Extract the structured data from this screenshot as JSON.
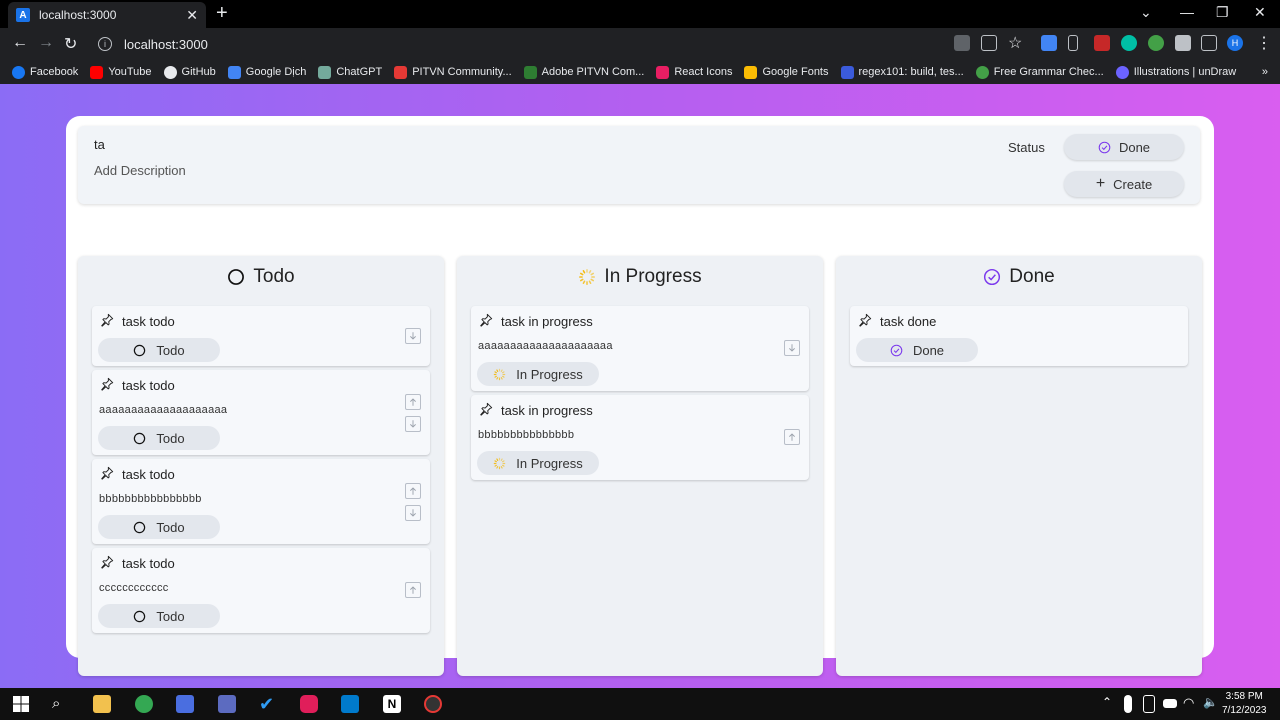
{
  "browser": {
    "tab_title": "localhost:3000",
    "tab_icon_letter": "A",
    "url": "localhost:3000",
    "bookmarks": [
      {
        "label": "Facebook",
        "icon": "facebook-icon",
        "color": "#1877f2"
      },
      {
        "label": "YouTube",
        "icon": "youtube-icon",
        "color": "#ff0000"
      },
      {
        "label": "GitHub",
        "icon": "github-icon",
        "color": "#e8eaed"
      },
      {
        "label": "Google Dịch",
        "icon": "google-translate-icon",
        "color": "#4285f4"
      },
      {
        "label": "ChatGPT",
        "icon": "chatgpt-icon",
        "color": "#74aa9c"
      },
      {
        "label": "PITVN Community...",
        "icon": "pitvn-icon",
        "color": "#e53935"
      },
      {
        "label": "Adobe PITVN Com...",
        "icon": "adobe-icon",
        "color": "#2e7d32"
      },
      {
        "label": "React Icons",
        "icon": "react-icons-icon",
        "color": "#e91e63"
      },
      {
        "label": "Google Fonts",
        "icon": "google-fonts-icon",
        "color": "#fbbc04"
      },
      {
        "label": "regex101: build, tes...",
        "icon": "regex101-icon",
        "color": "#3b5bdb"
      },
      {
        "label": "Free Grammar Chec...",
        "icon": "grammar-icon",
        "color": "#43a047"
      },
      {
        "label": "Illustrations | unDraw",
        "icon": "undraw-icon",
        "color": "#6c63ff"
      }
    ]
  },
  "form": {
    "title_value": "ta",
    "description_placeholder": "Add Description",
    "status_label": "Status",
    "status_value": "Done",
    "create_label": "Create"
  },
  "columns": [
    {
      "title": "Todo",
      "icon": "circle-icon",
      "tasks": [
        {
          "title": "task todo",
          "description": "",
          "status": "Todo"
        },
        {
          "title": "task todo",
          "description": "aaaaaaaaaaaaaaaaaaaa",
          "status": "Todo"
        },
        {
          "title": "task todo",
          "description": "bbbbbbbbbbbbbbbb",
          "status": "Todo"
        },
        {
          "title": "task todo",
          "description": "cccccccccccc",
          "status": "Todo"
        }
      ]
    },
    {
      "title": "In Progress",
      "icon": "loading-icon",
      "tasks": [
        {
          "title": "task in progress",
          "description": "aaaaaaaaaaaaaaaaaaaaa",
          "status": "In Progress"
        },
        {
          "title": "task in progress",
          "description": "bbbbbbbbbbbbbbb",
          "status": "In Progress"
        }
      ]
    },
    {
      "title": "Done",
      "icon": "check-circle-icon",
      "tasks": [
        {
          "title": "task done",
          "description": "",
          "status": "Done"
        }
      ]
    }
  ],
  "taskbar": {
    "time": "3:58 PM",
    "date": "7/12/2023"
  },
  "colors": {
    "done_accent": "#7c3aed",
    "progress_accent": "#f5b800"
  }
}
